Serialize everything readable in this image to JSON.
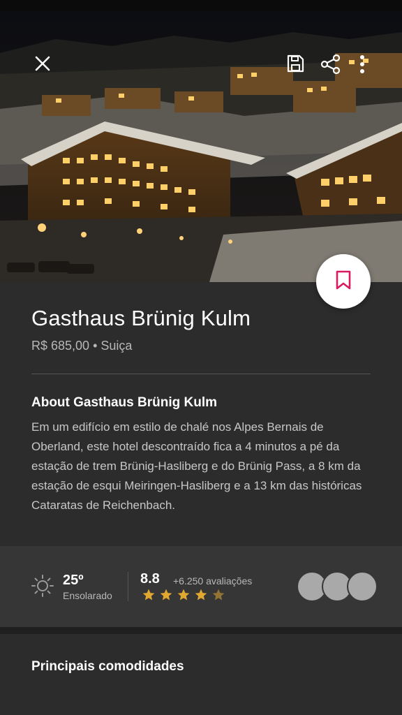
{
  "hero": {
    "close_icon": "close-icon",
    "save_icon": "floppy-disk-icon",
    "share_icon": "share-icon",
    "more_icon": "more-vertical-icon",
    "bookmark_icon": "bookmark-icon",
    "bookmark_color": "#d81b60"
  },
  "hotel": {
    "name": "Gasthaus Brünig Kulm",
    "price_location": "R$ 685,00 • Suiça"
  },
  "about": {
    "heading": "About Gasthaus Brünig Kulm",
    "text": "Em um edifício em estilo de chalé nos Alpes Bernais de Oberland, este hotel descontraído fica a 4 minutos a pé da estação de trem Brünig-Hasliberg e do Brünig Pass, a 8 km da estação de esqui Meiringen-Hasliberg e a 13 km das históricas Cataratas de Reichenbach."
  },
  "stats": {
    "weather_icon": "sun-icon",
    "temperature": "25º",
    "condition": "Ensolarado",
    "rating": "8.8",
    "reviews": "+6.250 avaliações",
    "stars_full": 4,
    "stars_total": 5,
    "star_color": "#e0a830"
  },
  "amenities": {
    "heading": "Principais comodidades"
  }
}
